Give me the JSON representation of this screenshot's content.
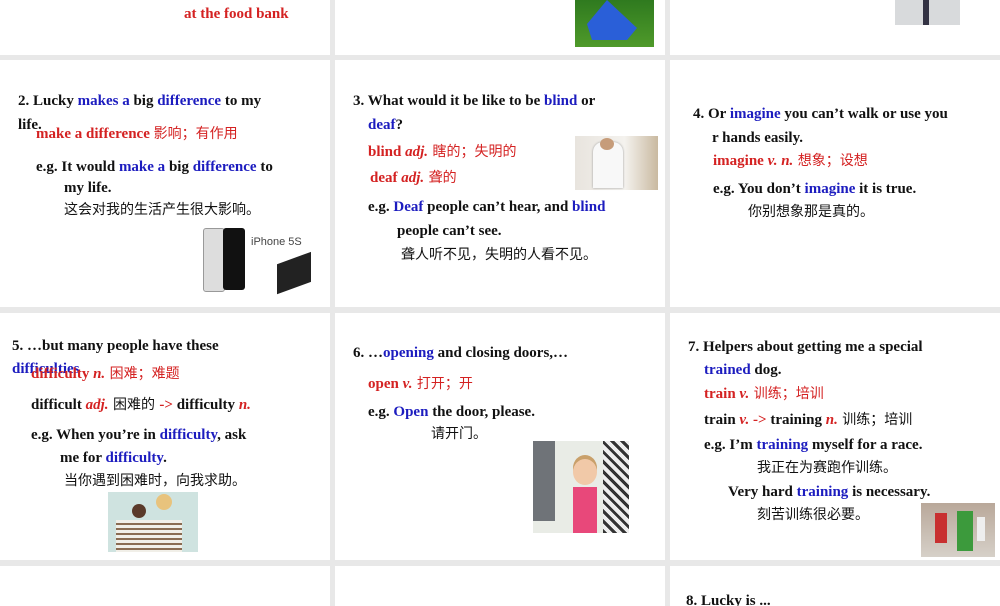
{
  "slides": [
    {
      "lines": [
        [
          {
            "t": "at the food bank",
            "c": "r"
          }
        ]
      ]
    },
    {
      "lines": []
    },
    {
      "lines": []
    },
    {
      "lines": [
        [
          {
            "t": "2. Lucky "
          },
          {
            "t": "makes a",
            "c": "b"
          },
          {
            "t": " big "
          },
          {
            "t": "difference",
            "c": "b"
          },
          {
            "t": " to my"
          }
        ],
        [
          {
            "t": "life."
          }
        ],
        [
          {
            "t": "make a difference  ",
            "c": "r"
          },
          {
            "t": "影响；有作用",
            "c": "zhr"
          }
        ],
        [
          {
            "t": "e.g. It would "
          },
          {
            "t": "make a",
            "c": "b"
          },
          {
            "t": " big "
          },
          {
            "t": "difference",
            "c": "b"
          },
          {
            "t": " to"
          }
        ],
        [
          {
            "t": "my life."
          }
        ],
        [
          {
            "t": "这会对我的生活产生很大影响。",
            "c": "zh"
          }
        ]
      ],
      "image_label": "iPhone 5S"
    },
    {
      "lines": [
        [
          {
            "t": "3. What would it be like to be "
          },
          {
            "t": "blind",
            "c": "b"
          },
          {
            "t": " or"
          }
        ],
        [
          {
            "t": "deaf",
            "c": "b"
          },
          {
            "t": "?"
          }
        ],
        [
          {
            "t": "blind  ",
            "c": "r"
          },
          {
            "t": "adj.",
            "c": "ri"
          },
          {
            "t": "  瞎的；失明的",
            "c": "zhr"
          }
        ],
        [
          {
            "t": "deaf   ",
            "c": "r"
          },
          {
            "t": "adj.",
            "c": "ri"
          },
          {
            "t": "  聋的",
            "c": "zhr"
          }
        ],
        [
          {
            "t": "e.g. "
          },
          {
            "t": "Deaf",
            "c": "b"
          },
          {
            "t": " people can’t hear, and "
          },
          {
            "t": "blind",
            "c": "b"
          }
        ],
        [
          {
            "t": "people can’t see."
          }
        ],
        [
          {
            "t": "聋人听不见，失明的人看不见。",
            "c": "zh"
          }
        ]
      ]
    },
    {
      "lines": [
        [
          {
            "t": "4. Or "
          },
          {
            "t": "imagine",
            "c": "b"
          },
          {
            "t": " you can’t walk or use you"
          }
        ],
        [
          {
            "t": "r hands easily."
          }
        ],
        [
          {
            "t": "imagine   ",
            "c": "r"
          },
          {
            "t": "v. n.",
            "c": "ri"
          },
          {
            "t": "  想象；设想",
            "c": "zhr"
          }
        ],
        [
          {
            "t": "e.g. You don’t "
          },
          {
            "t": "imagine",
            "c": "b"
          },
          {
            "t": " it is true."
          }
        ],
        [
          {
            "t": "你别想象那是真的。",
            "c": "zh"
          }
        ]
      ]
    },
    {
      "lines": [
        [
          {
            "t": "5. …but many people have these"
          }
        ],
        [
          {
            "t": "difficulties",
            "c": "b"
          }
        ],
        [
          {
            "t": "difficulty   ",
            "c": "r"
          },
          {
            "t": "n.",
            "c": "ri"
          },
          {
            "t": "  困难；难题",
            "c": "zhr"
          }
        ],
        [
          {
            "t": "difficult "
          },
          {
            "t": "adj.",
            "c": "ri"
          },
          {
            "t": " 困难的 ",
            "c": "zh"
          },
          {
            "t": " -> ",
            "c": "r"
          },
          {
            "t": "   difficulty "
          },
          {
            "t": "n.",
            "c": "ri"
          }
        ],
        [
          {
            "t": "e.g. When you’re in "
          },
          {
            "t": "difficulty",
            "c": "b"
          },
          {
            "t": ", ask"
          }
        ],
        [
          {
            "t": "me for "
          },
          {
            "t": "difficulty",
            "c": "b"
          },
          {
            "t": "."
          }
        ],
        [
          {
            "t": "当你遇到困难时，向我求助。",
            "c": "zh"
          }
        ]
      ]
    },
    {
      "lines": [
        [
          {
            "t": "6. …"
          },
          {
            "t": "opening",
            "c": "b"
          },
          {
            "t": " and closing doors,…"
          }
        ],
        [
          {
            "t": "open  ",
            "c": "r"
          },
          {
            "t": "v.",
            "c": "ri"
          },
          {
            "t": "  打开；开",
            "c": "zhr"
          }
        ],
        [
          {
            "t": "e.g. "
          },
          {
            "t": "Open",
            "c": "b"
          },
          {
            "t": " the door, please."
          }
        ],
        [
          {
            "t": "请开门。",
            "c": "zh"
          }
        ]
      ]
    },
    {
      "lines": [
        [
          {
            "t": "7. Helpers about getting me a special"
          }
        ],
        [
          {
            "t": "trained",
            "c": "b"
          },
          {
            "t": " dog."
          }
        ],
        [
          {
            "t": "train ",
            "c": "r"
          },
          {
            "t": "v.",
            "c": "ri"
          },
          {
            "t": "  训练；培训",
            "c": "zhr"
          }
        ],
        [
          {
            "t": "train "
          },
          {
            "t": "v.",
            "c": "ri"
          },
          {
            "t": "   -> ",
            "c": "r"
          },
          {
            "t": "  training "
          },
          {
            "t": "n.",
            "c": "ri"
          },
          {
            "t": "  训练；培训",
            "c": "zh"
          }
        ],
        [
          {
            "t": "e.g. I’m "
          },
          {
            "t": "training",
            "c": "b"
          },
          {
            "t": " myself for a race."
          }
        ],
        [
          {
            "t": "我正在为赛跑作训练。",
            "c": "zh"
          }
        ],
        [
          {
            "t": "Very hard "
          },
          {
            "t": "training",
            "c": "b"
          },
          {
            "t": " is necessary."
          }
        ],
        [
          {
            "t": "刻苦训练很必要。",
            "c": "zh"
          }
        ]
      ]
    },
    {
      "lines": []
    },
    {
      "lines": []
    },
    {
      "lines": [
        [
          {
            "t": "8. Lucky is ..."
          }
        ]
      ]
    }
  ]
}
